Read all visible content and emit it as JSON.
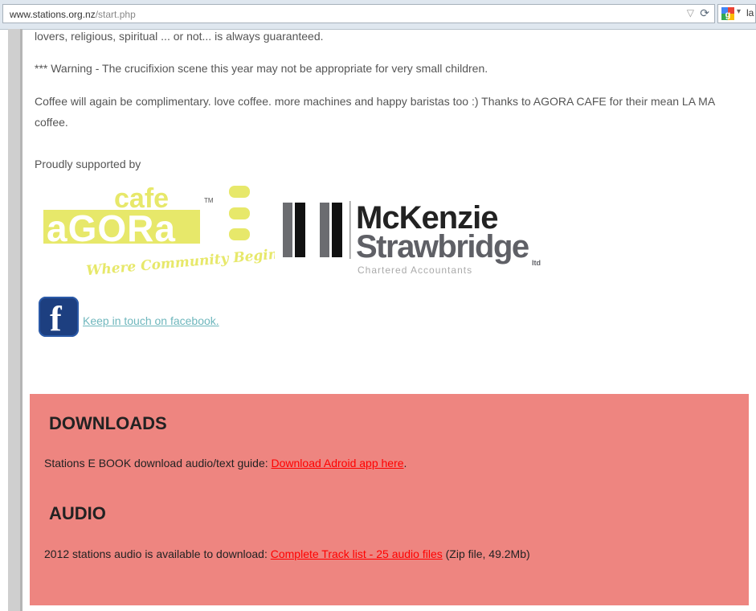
{
  "browser": {
    "url_host": "www.stations.org.nz",
    "url_path": "/start.php",
    "search_text": "la"
  },
  "content": {
    "line1": "lovers, religious, spiritual ... or not... is always guaranteed.",
    "warning": "*** Warning - The crucifixion scene this year may not be appropriate for very small children.",
    "coffee_line1": "Coffee will again be complimentary. love coffee. more machines and happy baristas too :) Thanks to AGORA CAFE for their mean LA MA",
    "coffee_line2": "coffee.",
    "supported_by": "Proudly supported by"
  },
  "sponsors": {
    "agora": {
      "cafe": "cafe",
      "tm": "TM",
      "name": "aGORa",
      "tagline": "Where Community Begins"
    },
    "mckenzie": {
      "line1": "McKenzie",
      "line2": "Strawbridge",
      "ltd": "ltd",
      "sub": "Chartered Accountants"
    }
  },
  "facebook": {
    "link_text": "Keep in touch on facebook."
  },
  "downloads": {
    "heading": "DOWNLOADS",
    "text": "Stations E BOOK download audio/text guide: ",
    "link": "Download Adroid app here",
    "suffix": "."
  },
  "audio": {
    "heading": "AUDIO",
    "text": "2012 stations audio is available to download: ",
    "link": "Complete Track list - 25 audio files",
    "suffix": " (Zip file, 49.2Mb)"
  },
  "colors": {
    "panel_bg": "#ee8580",
    "link_red": "#ff0000",
    "facebook_link": "#6fb7bd",
    "agora_yellow": "#e7e86a",
    "mckenzie_gray": "#5f6066"
  }
}
